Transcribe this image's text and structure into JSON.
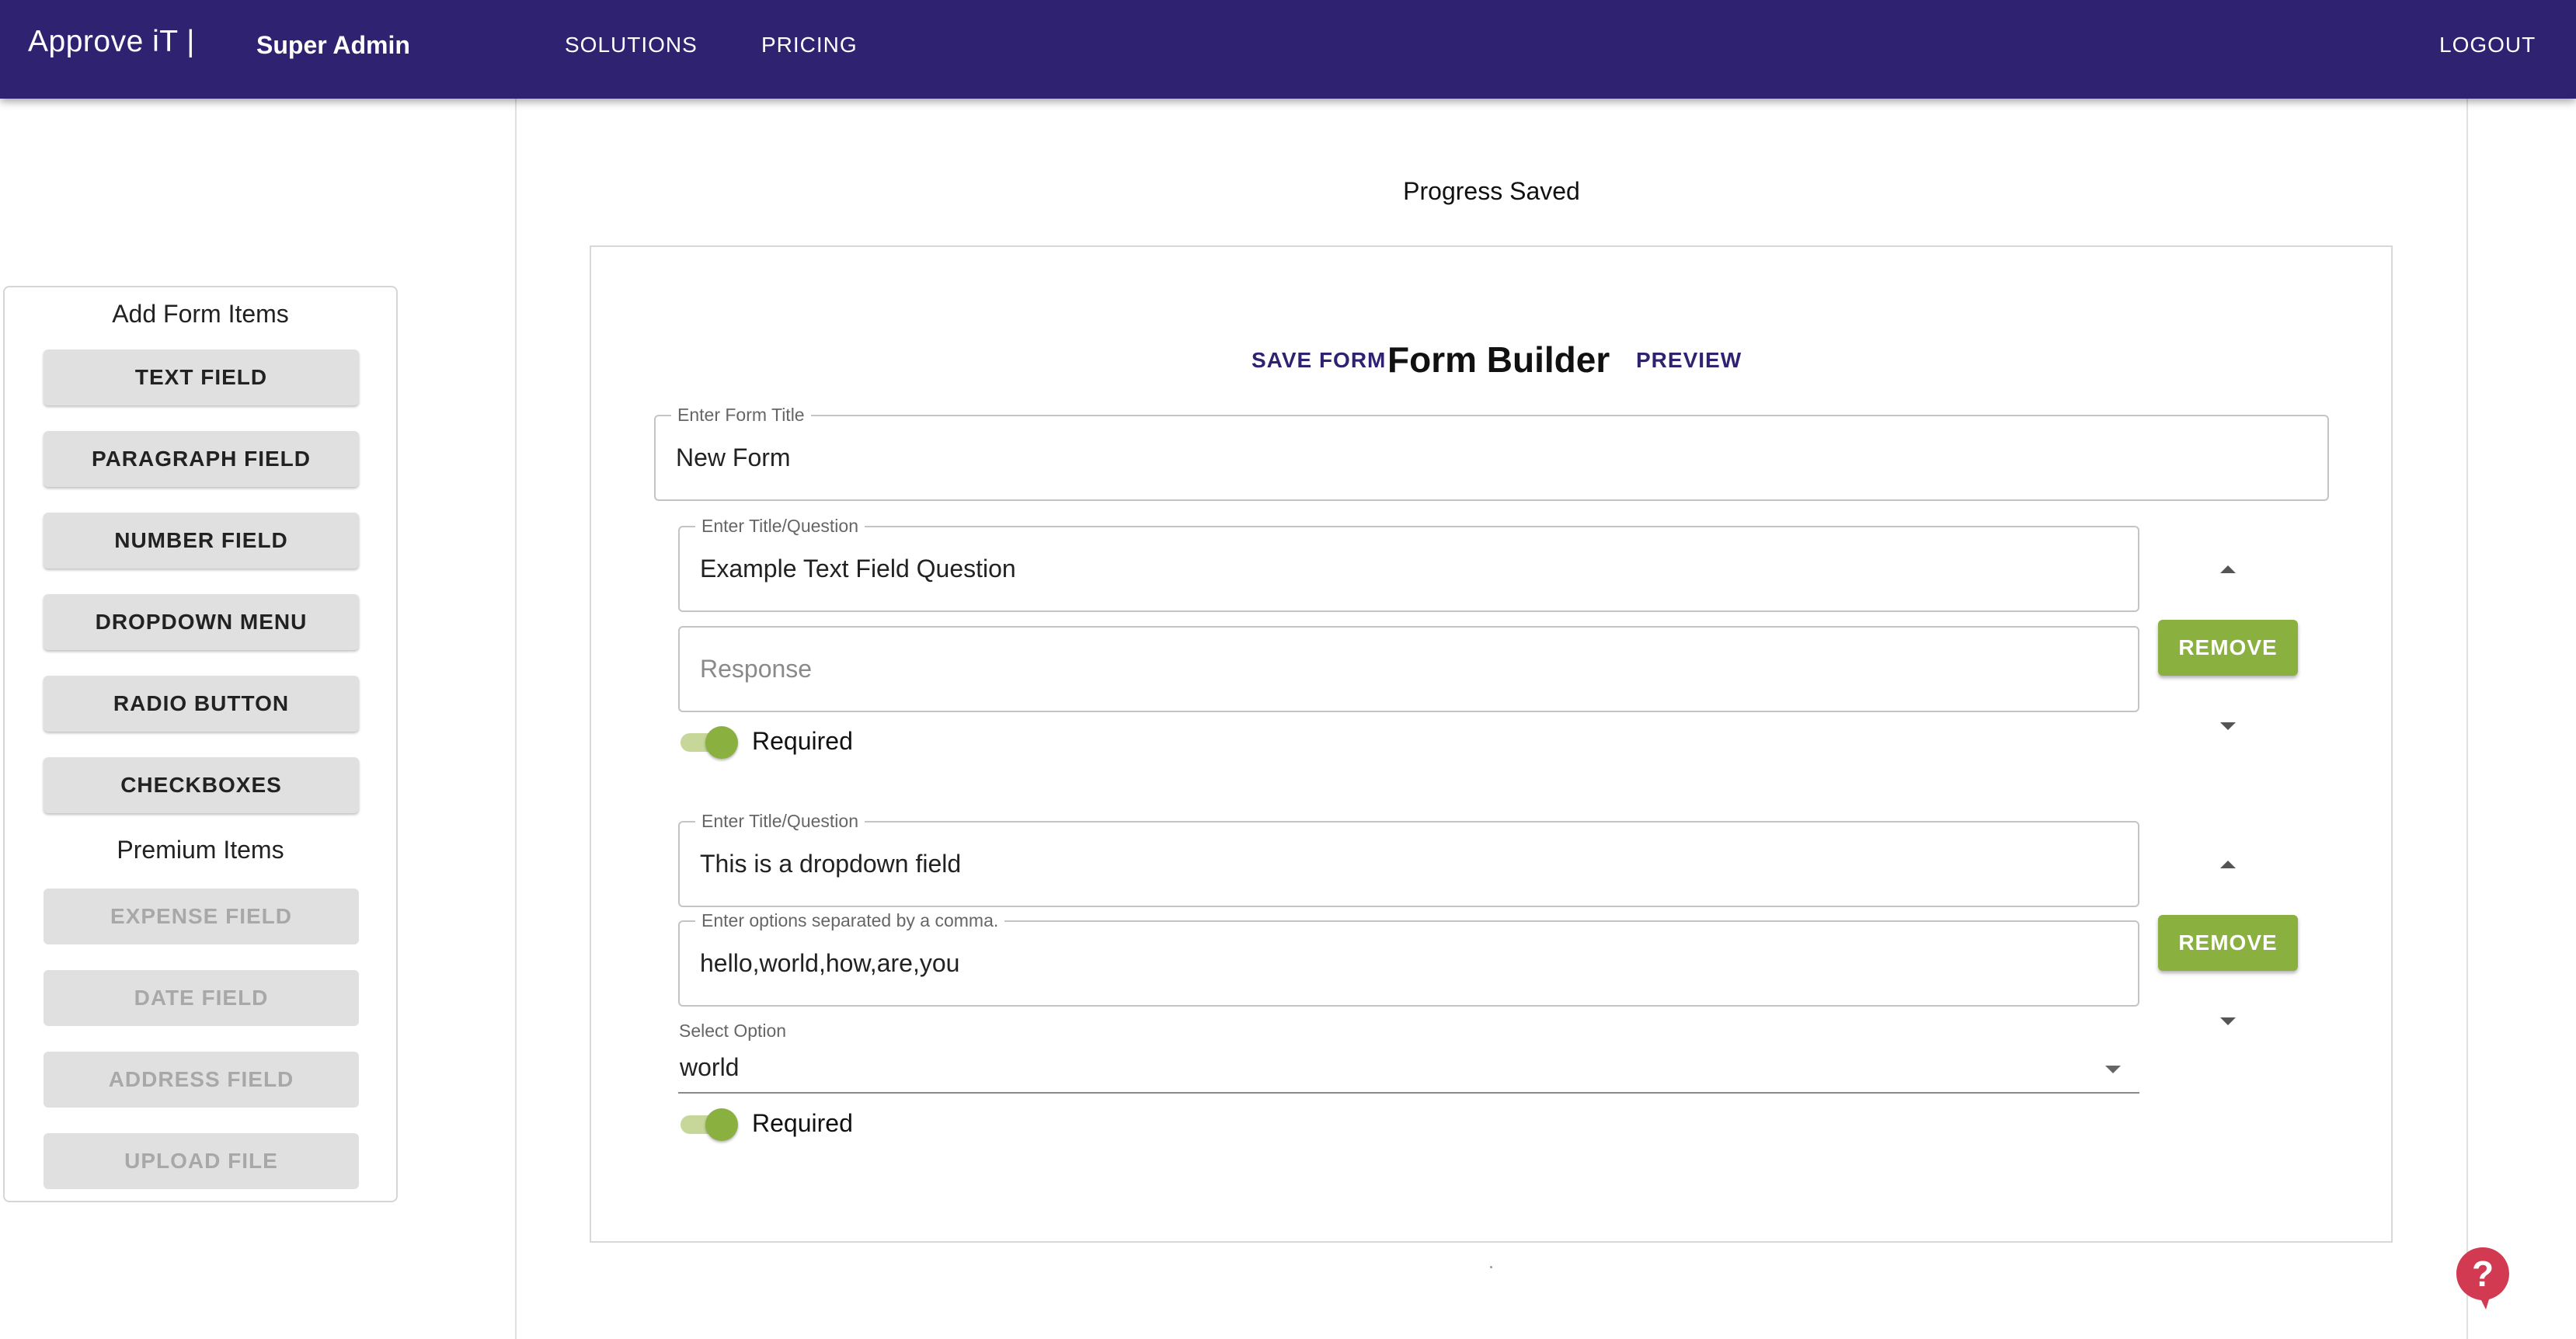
{
  "header": {
    "brand": "Approve iT |",
    "role": "Super Admin",
    "nav": {
      "solutions": "SOLUTIONS",
      "pricing": "PRICING",
      "logout": "LOGOUT"
    },
    "bar_color": "#2e2271"
  },
  "sidebar": {
    "add_heading": "Add Form Items",
    "items": [
      {
        "label": "TEXT FIELD"
      },
      {
        "label": "PARAGRAPH FIELD"
      },
      {
        "label": "NUMBER FIELD"
      },
      {
        "label": "DROPDOWN MENU"
      },
      {
        "label": "RADIO BUTTON"
      },
      {
        "label": "CHECKBOXES"
      }
    ],
    "premium_heading": "Premium Items",
    "premium_items": [
      {
        "label": "EXPENSE FIELD",
        "disabled": true
      },
      {
        "label": "DATE FIELD",
        "disabled": true
      },
      {
        "label": "ADDRESS FIELD",
        "disabled": true
      },
      {
        "label": "UPLOAD FILE",
        "disabled": true
      }
    ]
  },
  "main": {
    "status": "Progress Saved",
    "toolbar": {
      "save_label": "SAVE FORM",
      "title": "Form Builder",
      "preview_label": "PREVIEW"
    },
    "form_title": {
      "label": "Enter Form Title",
      "value": "New Form"
    },
    "questions": [
      {
        "title_label": "Enter Title/Question",
        "title_value": "Example Text Field Question",
        "response_placeholder": "Response",
        "required_label": "Required",
        "required": true,
        "remove_label": "REMOVE"
      },
      {
        "title_label": "Enter Title/Question",
        "title_value": "This is a dropdown field",
        "options_label": "Enter options separated by a comma.",
        "options_value": "hello,world,how,are,you",
        "select_label": "Select Option",
        "select_value": "world",
        "required_label": "Required",
        "required": true,
        "remove_label": "REMOVE"
      }
    ]
  },
  "colors": {
    "accent_green": "#8ab140",
    "help_red": "#d23a52"
  },
  "icons": {
    "move_up": "arrow-up-icon",
    "move_down": "arrow-down-icon",
    "help": "help-icon",
    "dropdown": "chevron-down-icon"
  }
}
